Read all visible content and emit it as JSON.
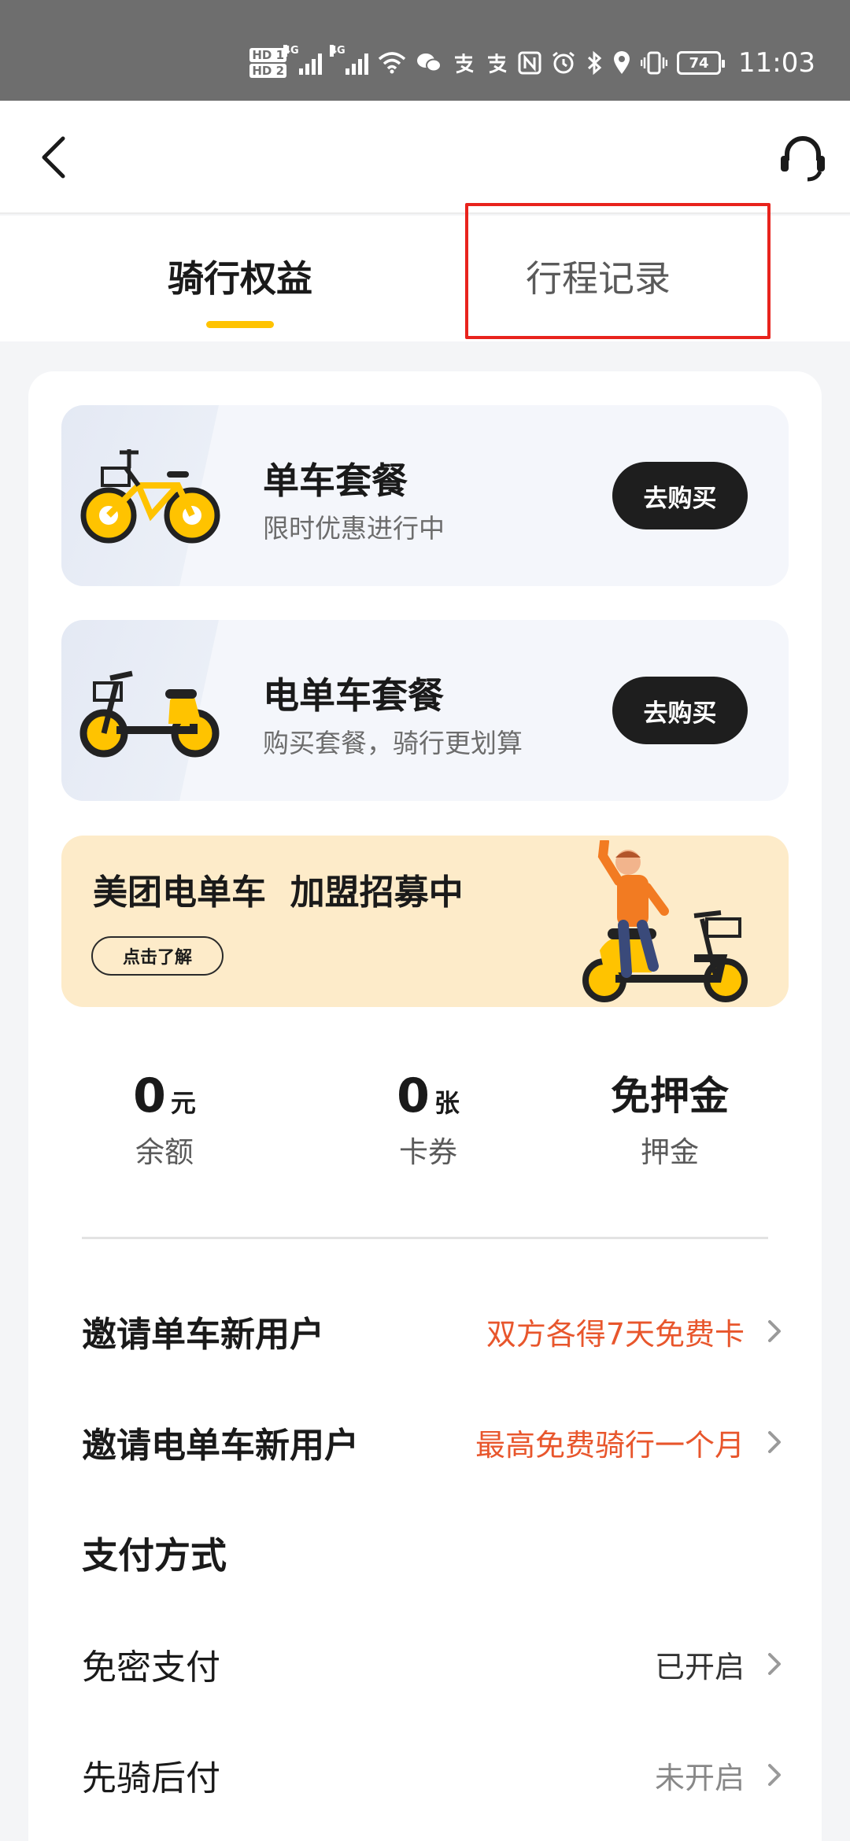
{
  "status_bar": {
    "hd1": "HD 1",
    "hd2": "HD 2",
    "net1": "4G",
    "net2": "4G",
    "battery": "74",
    "time": "11:03"
  },
  "nav": {
    "back_icon": "chevron-left-icon",
    "service_icon": "headset-icon"
  },
  "tabs": [
    {
      "label": "骑行权益",
      "active": true
    },
    {
      "label": "行程记录",
      "active": false
    }
  ],
  "packages": [
    {
      "title": "单车套餐",
      "subtitle": "限时优惠进行中",
      "button": "去购买"
    },
    {
      "title": "电单车套餐",
      "subtitle": "购买套餐，骑行更划算",
      "button": "去购买"
    }
  ],
  "join_banner": {
    "title": "美团电单车  加盟招募中",
    "button": "点击了解"
  },
  "stats": [
    {
      "value": "0",
      "unit": "元",
      "label": "余额"
    },
    {
      "value": "0",
      "unit": "张",
      "label": "卡券"
    },
    {
      "value": "免押金",
      "label": "押金"
    }
  ],
  "rows": {
    "invite_bike": {
      "title": "邀请单车新用户",
      "value": "双方各得7天免费卡"
    },
    "invite_ebike": {
      "title": "邀请电单车新用户",
      "value": "最高免费骑行一个月"
    },
    "payment_section": "支付方式",
    "no_pwd_pay": {
      "title": "免密支付",
      "value": "已开启"
    },
    "ride_first_pay": {
      "title": "先骑后付",
      "value": "未开启"
    }
  },
  "colors": {
    "accent_yellow": "#ffc300",
    "highlight_red": "#e8231d",
    "promo_orange": "#e8562c",
    "banner_bg": "#fdebc9"
  }
}
